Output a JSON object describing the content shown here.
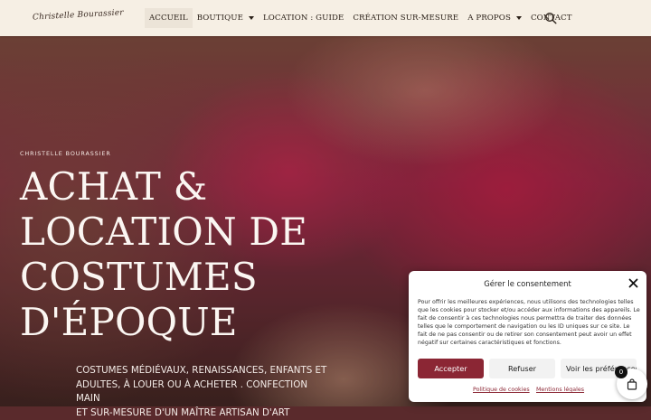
{
  "header": {
    "logo_text": "Christelle Bourassier",
    "nav": [
      {
        "label": "ACCUEIL",
        "dropdown": false,
        "active": true
      },
      {
        "label": "BOUTIQUE",
        "dropdown": true
      },
      {
        "label": "LOCATION : GUIDE",
        "dropdown": false
      },
      {
        "label": "CRÉATION SUR-MESURE",
        "dropdown": false
      },
      {
        "label": "A PROPOS",
        "dropdown": true
      },
      {
        "label": "CONTACT",
        "dropdown": false
      }
    ],
    "search_icon": "search-icon",
    "background_color": "#f6efe4"
  },
  "hero": {
    "kicker": "CHRISTELLE BOURASSIER",
    "title_lines": [
      "ACHAT &",
      "LOCATION DE",
      "COSTUMES",
      "D'ÉPOQUE"
    ],
    "subtitle_lines": [
      "COSTUMES MÉDIÉVAUX, RENAISSANCES, ENFANTS ET",
      "ADULTES, À LOUER OU À ACHETER . CONFECTION MAIN",
      "ET SUR-MESURE D'UN MAÎTRE ARTISAN D'ART"
    ]
  },
  "consent": {
    "title": "Gérer le consentement",
    "text": "Pour offrir les meilleures expériences, nous utilisons des technologies telles que les cookies pour stocker et/ou accéder aux informations des appareils. Le fait de consentir à ces technologies nous permettra de traiter des données telles que le comportement de navigation ou les ID uniques sur ce site. Le fait de ne pas consentir ou de retirer son consentement peut avoir un effet négatif sur certaines caractéristiques et fonctions.",
    "accept_label": "Accepter",
    "refuse_label": "Refuser",
    "prefs_label": "Voir les préférences",
    "cookie_policy_label": "Politique de cookies",
    "legal_label": "Mentions légales",
    "accent_color": "#8b2634"
  },
  "cart": {
    "count": "0",
    "icon": "shopping-bag-icon"
  }
}
